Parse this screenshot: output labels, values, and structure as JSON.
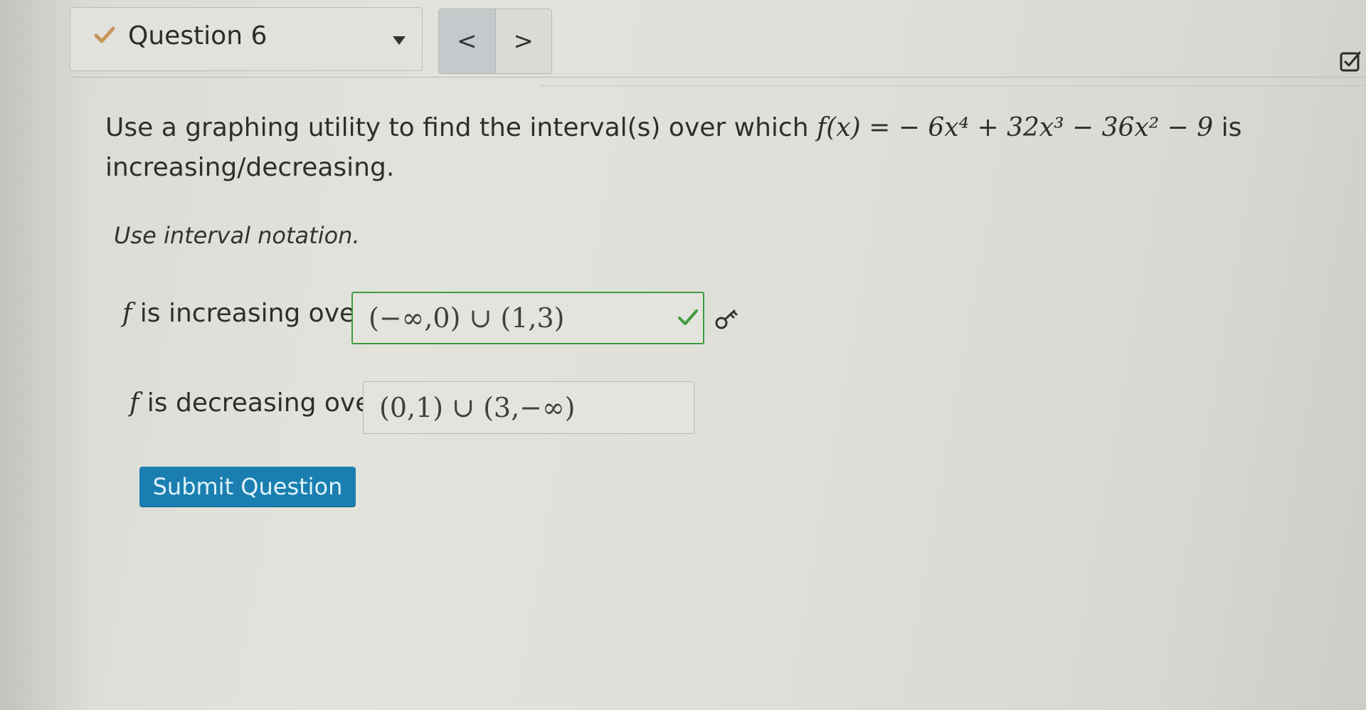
{
  "header": {
    "question_label": "Question 6",
    "prev_label": "<",
    "next_label": ">"
  },
  "question": {
    "prompt_text": "Use a graphing utility to find the interval(s) over which",
    "function_lhs": "f(x) =",
    "function_rhs": "− 6x⁴ + 32x³ − 36x² − 9",
    "prompt_tail": "is",
    "prompt_line2": "increasing/decreasing.",
    "instruction": "Use interval notation."
  },
  "answers": {
    "increasing_label": "is increasing over",
    "increasing_value": "(−∞,0) ∪ (1,3)",
    "decreasing_label": "is decreasing over",
    "decreasing_value": "(0,1) ∪ (3,−∞)",
    "function_name": "f"
  },
  "actions": {
    "submit_label": "Submit Question"
  },
  "colors": {
    "accent": "#1a7fb0",
    "correct": "#3f9a3f",
    "status_check": "#c8955a"
  },
  "icons": {
    "question_status": "check-icon",
    "correct": "checkmark-icon",
    "hint": "key-icon",
    "top_right": "edit-checkbox-icon"
  }
}
